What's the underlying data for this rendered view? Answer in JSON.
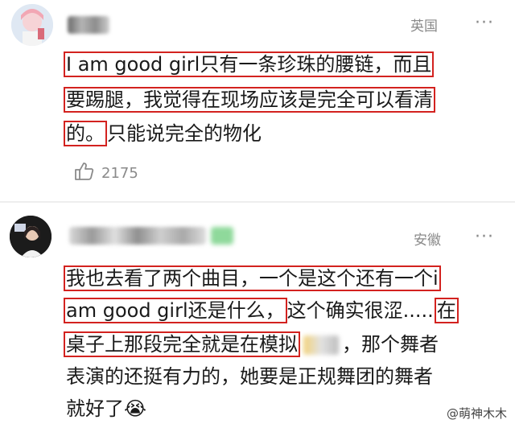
{
  "comments": [
    {
      "location": "英国",
      "more": "···",
      "lines": [
        {
          "hl": "I am good girl只有一条珍珠的腰链，而且",
          "rest": ""
        },
        {
          "hl": "要踢腿，我觉得在现场应该是完全可以看清",
          "rest": ""
        },
        {
          "hl": "的。",
          "rest": "只能说完全的物化"
        }
      ],
      "likes": "2175"
    },
    {
      "location": "安徽",
      "more": "···",
      "lines": [
        {
          "hl": "我也去看了两个曲目，一个是这个还有一个i",
          "rest": ""
        },
        {
          "hl": "am good girl还是什么，",
          "rest": "这个确实很涩.....",
          "hl2": "在"
        },
        {
          "hl": "桌子上那段完全就是在模拟",
          "rest": "，那个舞者"
        },
        {
          "hl": "表演的还挺有力的，她要是正规舞团的舞者",
          "rest": ""
        },
        {
          "hl": "就好了",
          "rest": "😭"
        }
      ]
    }
  ],
  "watermark": "@萌神木木",
  "colors": {
    "highlight": "#d3221f",
    "meta": "#8a8a8a"
  }
}
